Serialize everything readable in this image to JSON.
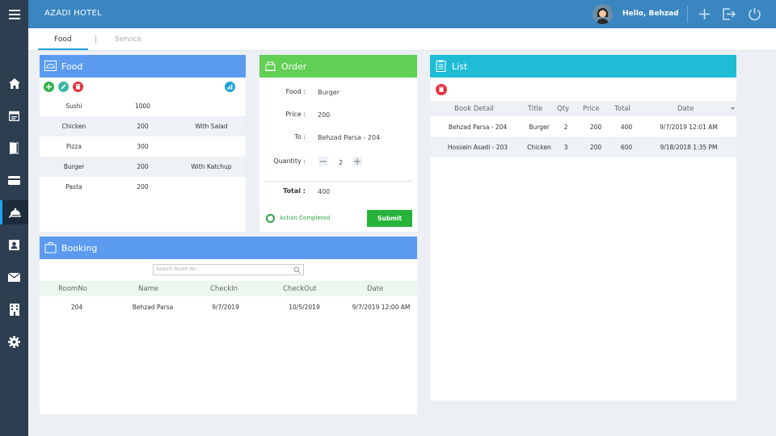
{
  "app": {
    "title": "AZADI HOTEL",
    "greeting": "Hello, Behzad"
  },
  "tabs": [
    {
      "label": "Food"
    },
    {
      "label": "|"
    },
    {
      "label": "Service"
    }
  ],
  "food": {
    "title": "Food",
    "rows": [
      {
        "name": "Sushi",
        "price": "1000",
        "note": ""
      },
      {
        "name": "Chicken",
        "price": "200",
        "note": "With Salad"
      },
      {
        "name": "Pizza",
        "price": "300",
        "note": ""
      },
      {
        "name": "Burger",
        "price": "200",
        "note": "With Katchup"
      },
      {
        "name": "Pasta",
        "price": "200",
        "note": ""
      }
    ]
  },
  "order": {
    "title": "Order",
    "food_label": "Food :",
    "food_value": "Burger",
    "price_label": "Price :",
    "price_value": "200",
    "to_label": "To :",
    "to_value": "Behzad Parsa - 204",
    "quantity_label": "Quantity :",
    "quantity_value": "2",
    "total_label": "Total :",
    "total_value": "400",
    "status": "Action Completed",
    "submit": "Submit"
  },
  "list": {
    "title": "List",
    "headers": [
      "Book Detail",
      "Title",
      "Qty",
      "Price",
      "Total",
      "Date"
    ],
    "rows": [
      {
        "book": "Behzad Parsa - 204",
        "title": "Burger",
        "qty": "2",
        "price": "200",
        "total": "400",
        "date": "9/7/2019 12:01 AM"
      },
      {
        "book": "Hossein Asadi - 203",
        "title": "Chicken",
        "qty": "3",
        "price": "200",
        "total": "600",
        "date": "9/18/2018 1:35 PM"
      }
    ]
  },
  "booking": {
    "title": "Booking",
    "search_placeholder": "Search Room No ...",
    "headers": [
      "RoomNo",
      "Name",
      "CheckIn",
      "CheckOut",
      "Date"
    ],
    "rows": [
      {
        "room": "204",
        "name": "Behzad Parsa",
        "checkin": "9/7/2019",
        "checkout": "10/5/2019",
        "date": "9/7/2019 12:00 AM"
      }
    ]
  },
  "colors": {
    "topbar": "#3a86c0",
    "sidebar": "#2c3e50",
    "food_header": "#5b9bef",
    "order_header": "#62cf55",
    "list_header": "#1fbcd6",
    "booking_header": "#5b9bef",
    "submit": "#27b33a"
  },
  "icons": [
    "menu-icon",
    "home-icon",
    "calendar-icon",
    "door-icon",
    "card-icon",
    "room-service-icon",
    "contact-icon",
    "mail-icon",
    "building-icon",
    "settings-icon",
    "plus-icon",
    "logout-icon",
    "power-icon"
  ]
}
